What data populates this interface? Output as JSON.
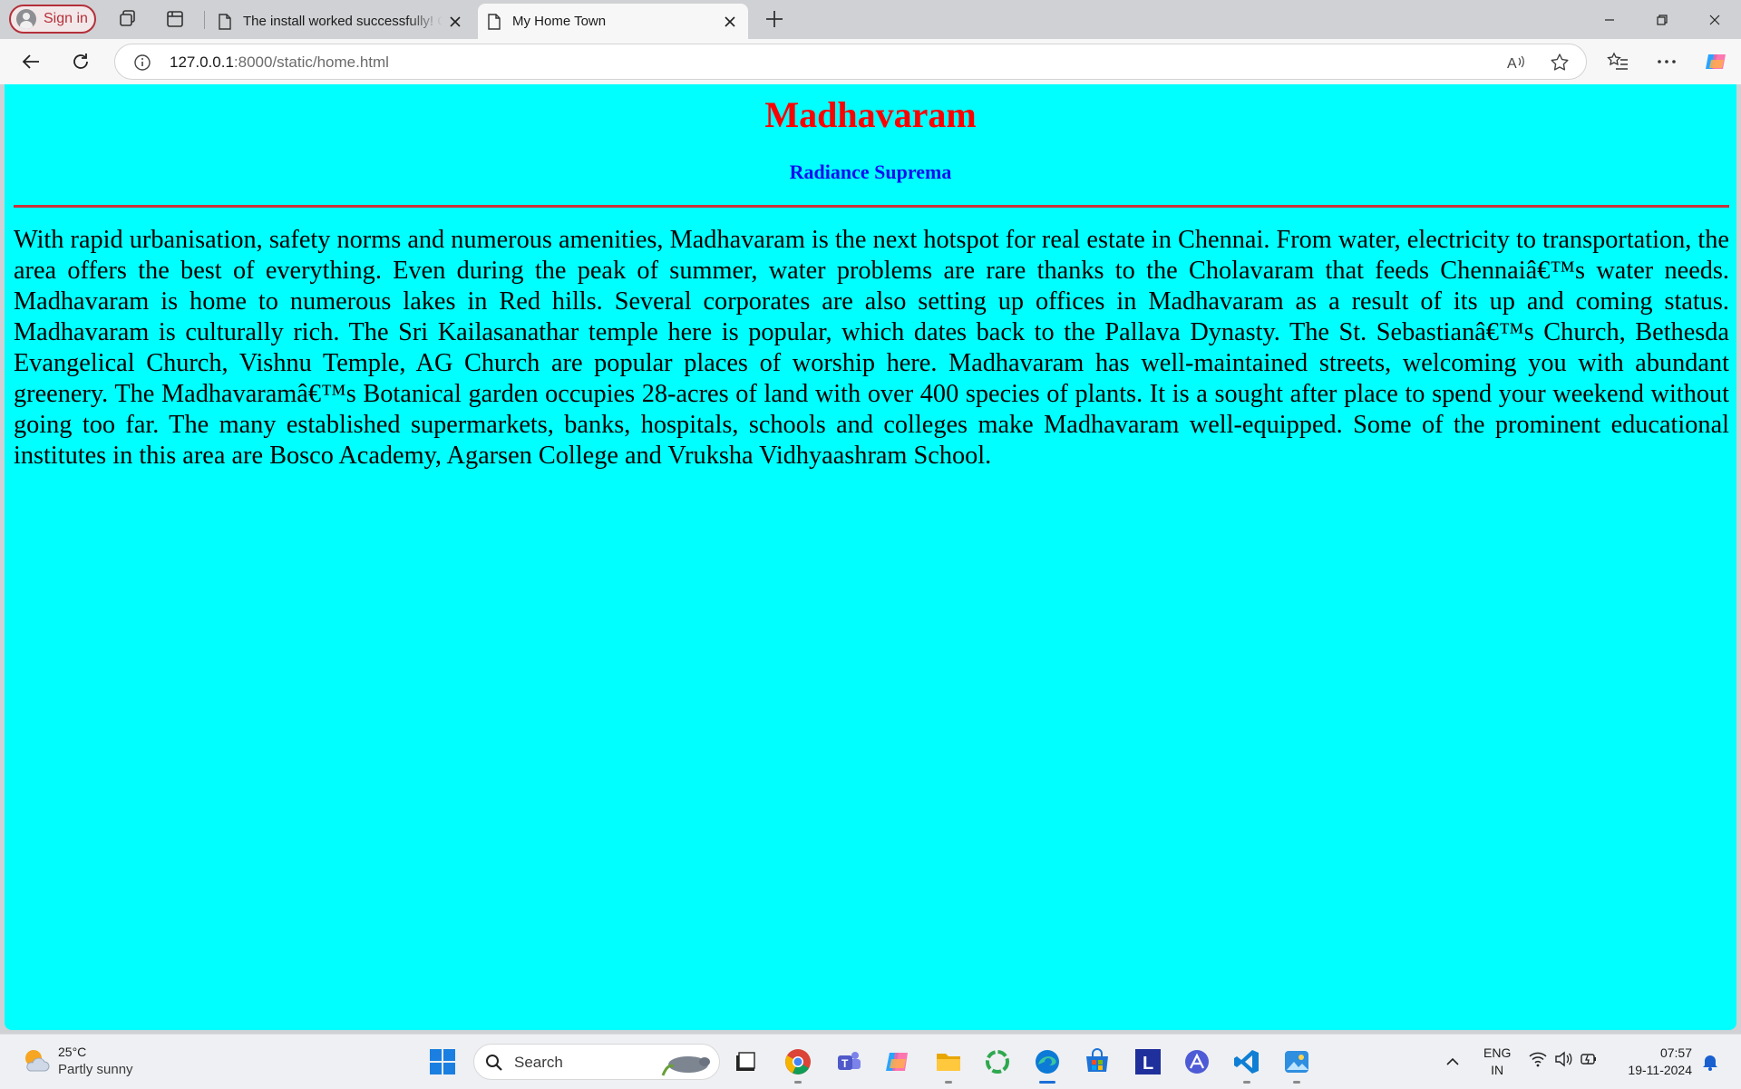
{
  "browser": {
    "sign_in_label": "Sign in",
    "tabs": [
      {
        "title": "The install worked successfully! Congratulations!",
        "active": false
      },
      {
        "title": "My Home Town",
        "active": true
      }
    ],
    "url_host": "127.0.0.1",
    "url_rest": ":8000/static/home.html"
  },
  "page": {
    "background_color": "#00ffff",
    "title": "Madhavaram",
    "title_color": "#ff0000",
    "subtitle": "Radiance Suprema",
    "subtitle_color": "#1010ee",
    "divider_color": "#c8323c",
    "body": "With rapid urbanisation, safety norms and numerous amenities, Madhavaram is the next hotspot for real estate in Chennai. From water, electricity to transportation, the area offers the best of everything. Even during the peak of summer, water problems are rare thanks to the Cholavaram that feeds Chennaiâ€™s water needs. Madhavaram is home to numerous lakes in Red hills. Several corporates are also setting up offices in Madhavaram as a result of its up and coming status. Madhavaram is culturally rich. The Sri Kailasanathar temple here is popular, which dates back to the Pallava Dynasty. The St. Sebastianâ€™s Church, Bethesda Evangelical Church, Vishnu Temple, AG Church are popular places of worship here. Madhavaram has well-maintained streets, welcoming you with abundant greenery. The Madhavaramâ€™s Botanical garden occupies 28-acres of land with over 400 species of plants. It is a sought after place to spend your weekend without going too far. The many established supermarkets, banks, hospitals, schools and colleges make Madhavaram well-equipped. Some of the prominent educational institutes in this area are Bosco Academy, Agarsen College and Vruksha Vidhyaashram School."
  },
  "taskbar": {
    "weather_temp": "25°C",
    "weather_desc": "Partly sunny",
    "search_label": "Search",
    "lang_1": "ENG",
    "lang_2": "IN",
    "time": "07:57",
    "date": "19-11-2024",
    "apps": [
      "file-explorer-icon",
      "chrome-icon",
      "teams-icon",
      "copilot-icon",
      "folder-icon",
      "refresh-app-icon",
      "edge-icon",
      "store-icon",
      "l-app-icon",
      "arc-app-icon",
      "vscode-icon",
      "photos-icon"
    ]
  }
}
